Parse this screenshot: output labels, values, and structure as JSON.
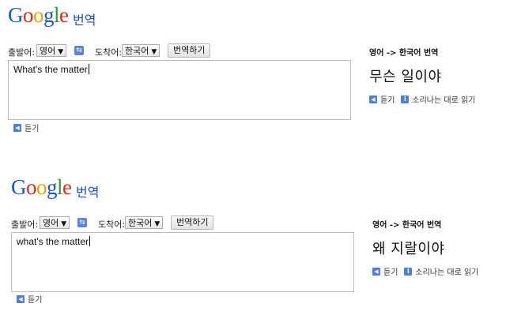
{
  "panels": [
    {
      "logo_letters": [
        "G",
        "o",
        "o",
        "g",
        "l",
        "e"
      ],
      "logo_sub": "번역",
      "from_label": "출발어:",
      "from_value": "영어",
      "to_label": "도착어:",
      "to_value": "한국어",
      "translate_button": "번역하기",
      "input_text": "What's the matter",
      "listen_label": "듣기",
      "direction": "영어 -> 한국어 번역",
      "result": "무슨 일이야",
      "result_listen": "듣기",
      "phonetic_label": "소리나는 대로 읽기"
    },
    {
      "logo_letters": [
        "G",
        "o",
        "o",
        "g",
        "l",
        "e"
      ],
      "logo_sub": "번역",
      "from_label": "출발어:",
      "from_value": "영어",
      "to_label": "도착어:",
      "to_value": "한국어",
      "translate_button": "번역하기",
      "input_text": "what's the matter",
      "listen_label": "듣기",
      "direction": "영어 -> 한국어 번역",
      "result": "왜 지랄이야",
      "result_listen": "듣기",
      "phonetic_label": "소리나는 대로 읽기"
    }
  ],
  "icons": {
    "dropdown_arrow": "▼",
    "swap": "⇆",
    "speaker": "◀",
    "info": "i"
  }
}
